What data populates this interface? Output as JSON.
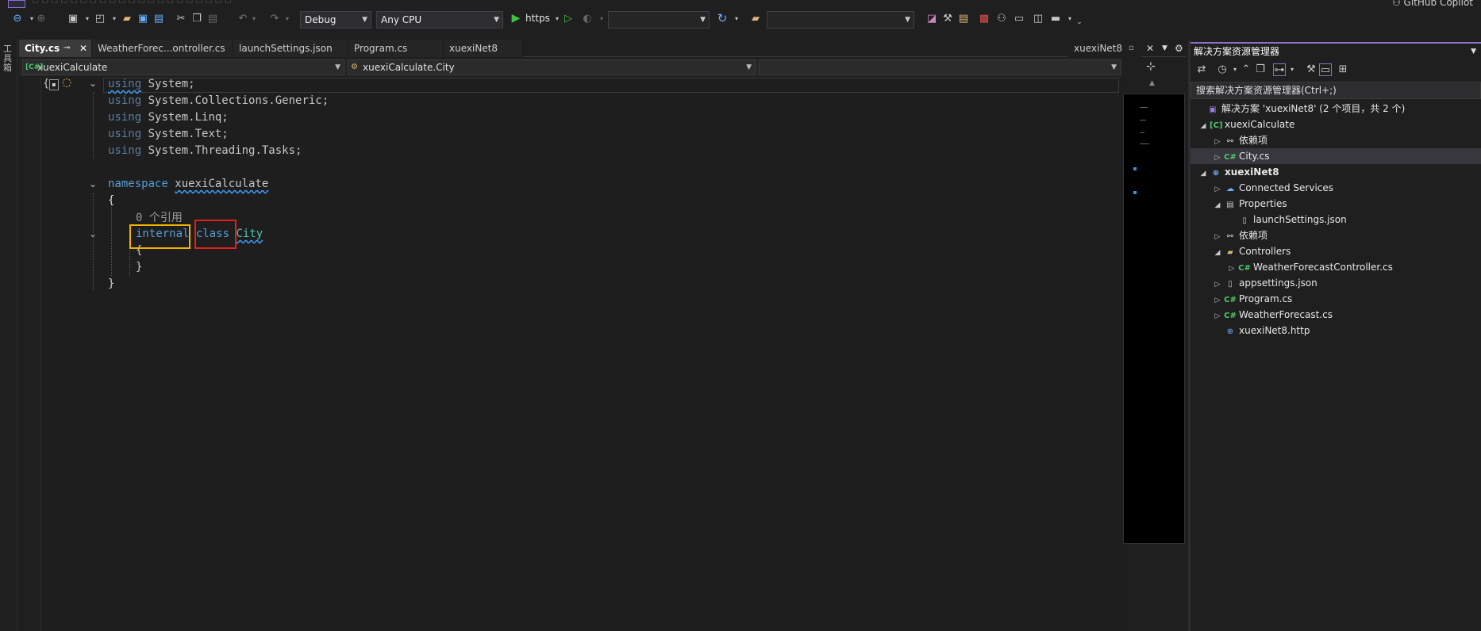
{
  "top_toolbar": {
    "config": "Debug",
    "platform": "Any CPU",
    "run_label": "https",
    "github_copilot": "GitHub Copilot"
  },
  "left_strip": {
    "toolbox_label": "工具箱"
  },
  "tabs": [
    {
      "label": "City.cs",
      "active": true
    },
    {
      "label": "WeatherForec...ontroller.cs"
    },
    {
      "label": "launchSettings.json"
    },
    {
      "label": "Program.cs"
    },
    {
      "label": "xuexiNet8"
    },
    {
      "label": "xuexiNet8"
    }
  ],
  "nav": {
    "project": "xuexiCalculate",
    "type": "xuexiCalculate.City",
    "member": ""
  },
  "code": {
    "using_kw": "using",
    "u1": " System;",
    "u2": " System.Collections.Generic;",
    "u3": " System.Linq;",
    "u4": " System.Text;",
    "u5": " System.Threading.Tasks;",
    "ns_kw": "namespace",
    "ns_name": "xuexiCalculate",
    "brace_open": "{",
    "refs": "0 个引用",
    "internal_kw": "internal",
    "class_kw": "class",
    "class_name": "City",
    "inner_open": "{",
    "inner_close": "}",
    "brace_close": "}"
  },
  "highlight_colors": {
    "internal_box": "#f0b400",
    "class_box": "#e02020"
  },
  "solution_explorer": {
    "title": "解决方案资源管理器",
    "search_placeholder": "搜索解决方案资源管理器(Ctrl+;)",
    "items": [
      {
        "label": "解决方案 'xuexiNet8' (2 个项目，共 2 个)",
        "icon": "solution-icon"
      },
      {
        "label": "xuexiCalculate",
        "icon": "csproj-icon"
      },
      {
        "label": "依赖项",
        "icon": "dependencies-icon"
      },
      {
        "label": "City.cs",
        "icon": "csharp-file-icon"
      },
      {
        "label": "xuexiNet8",
        "icon": "web-project-icon"
      },
      {
        "label": "Connected Services",
        "icon": "connected-services-icon"
      },
      {
        "label": "Properties",
        "icon": "properties-icon"
      },
      {
        "label": "launchSettings.json",
        "icon": "json-file-icon"
      },
      {
        "label": "依赖项",
        "icon": "dependencies-icon"
      },
      {
        "label": "Controllers",
        "icon": "folder-icon"
      },
      {
        "label": "WeatherForecastController.cs",
        "icon": "csharp-file-icon"
      },
      {
        "label": "appsettings.json",
        "icon": "json-file-icon"
      },
      {
        "label": "Program.cs",
        "icon": "csharp-file-icon"
      },
      {
        "label": "WeatherForecast.cs",
        "icon": "csharp-file-icon"
      },
      {
        "label": "xuexiNet8.http",
        "icon": "http-file-icon"
      }
    ]
  }
}
